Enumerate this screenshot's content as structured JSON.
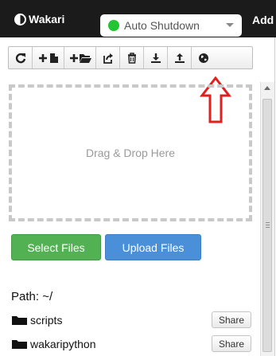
{
  "app": {
    "name": "Wakari",
    "shutdown_label": "Auto Shutdown",
    "shutdown_status_color": "#22c532",
    "add_label": "Add"
  },
  "toolbar": {
    "buttons": [
      {
        "name": "refresh",
        "icon": "refresh-icon"
      },
      {
        "name": "new-file",
        "icon": "new-file-icon"
      },
      {
        "name": "new-folder",
        "icon": "new-folder-icon"
      },
      {
        "name": "share",
        "icon": "share-icon"
      },
      {
        "name": "delete",
        "icon": "trash-icon"
      },
      {
        "name": "download",
        "icon": "download-icon"
      },
      {
        "name": "upload",
        "icon": "upload-icon"
      },
      {
        "name": "globe",
        "icon": "globe-icon"
      }
    ]
  },
  "annotation": {
    "color": "#e02020"
  },
  "dropzone": {
    "text": "Drag & Drop Here"
  },
  "actions": {
    "select_files": "Select Files",
    "upload_files": "Upload Files",
    "select_color": "#52b153",
    "upload_color": "#4a90d9"
  },
  "files": {
    "path_label": "Path: ~/",
    "items": [
      {
        "name": "scripts",
        "share_label": "Share"
      },
      {
        "name": "wakaripython",
        "share_label": "Share"
      }
    ]
  }
}
